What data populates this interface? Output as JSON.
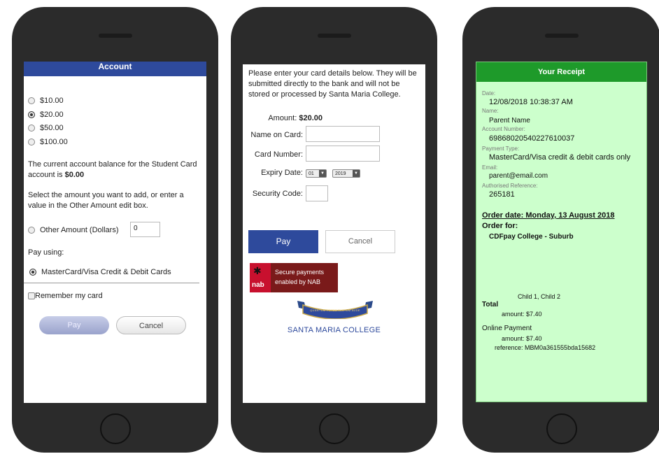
{
  "phone1": {
    "header": "Account",
    "amounts": [
      {
        "label": "$10.00",
        "selected": false
      },
      {
        "label": "$20.00",
        "selected": true
      },
      {
        "label": "$50.00",
        "selected": false
      },
      {
        "label": "$100.00",
        "selected": false
      }
    ],
    "balance_text": "The current account balance for the Student Card account is ",
    "balance_value": "$0.00",
    "instructions": "Select the amount you want to add, or enter a value in the Other Amount edit box.",
    "other_amount_label": "Other Amount (Dollars)",
    "other_amount_value": "0",
    "pay_using_label": "Pay using:",
    "payment_method": "MasterCard/Visa Credit & Debit Cards",
    "remember_label": "Remember my card",
    "pay_button": "Pay",
    "cancel_button": "Cancel"
  },
  "phone2": {
    "intro": "Please enter your card details below. They will be submitted directly to the bank and will not be stored or processed by Santa Maria College.",
    "amount_label": "Amount:",
    "amount_value": "$20.00",
    "name_label": "Name on Card:",
    "card_label": "Card Number:",
    "expiry_label": "Expiry Date:",
    "expiry_month": "01",
    "expiry_year": "2019",
    "security_label": "Security Code:",
    "pay_button": "Pay",
    "cancel_button": "Cancel",
    "nab_logo": "nab",
    "nab_line1": "Secure payments",
    "nab_line2": "enabled by NAB",
    "college_motto": "QUANTUM POTES TANTUM AUDE",
    "college_name": "SANTA MARIA COLLEGE",
    "colors": {
      "nab_red": "#c8102e",
      "pay_blue": "#2e4a9c"
    }
  },
  "phone3": {
    "header": "Your Receipt",
    "date_label": "Date:",
    "date_value": "12/08/2018 10:38:37 AM",
    "name_label": "Name:",
    "name_value": "Parent Name",
    "account_label": "Account Number:",
    "account_value": "69868020540227610037",
    "payment_type_label": "Payment Type:",
    "payment_type_value": "MasterCard/Visa credit & debit cards only",
    "email_label": "Email:",
    "email_value": "parent@email.com",
    "auth_label": "Authorised Reference:",
    "auth_value": "265181",
    "order_date": "Order date: Monday, 13 August 2018",
    "order_for_label": "Order for:",
    "order_for_value": "CDFpay College - Suburb",
    "children": "Child 1, Child 2",
    "total_label": "Total",
    "total_amount": "amount: $7.40",
    "online_payment_label": "Online Payment",
    "online_amount": "amount: $7.40",
    "reference": "reference: MBM0a361555bda15682",
    "colors": {
      "header_green": "#1e9a2a",
      "bg_green": "#ccffcc"
    }
  }
}
